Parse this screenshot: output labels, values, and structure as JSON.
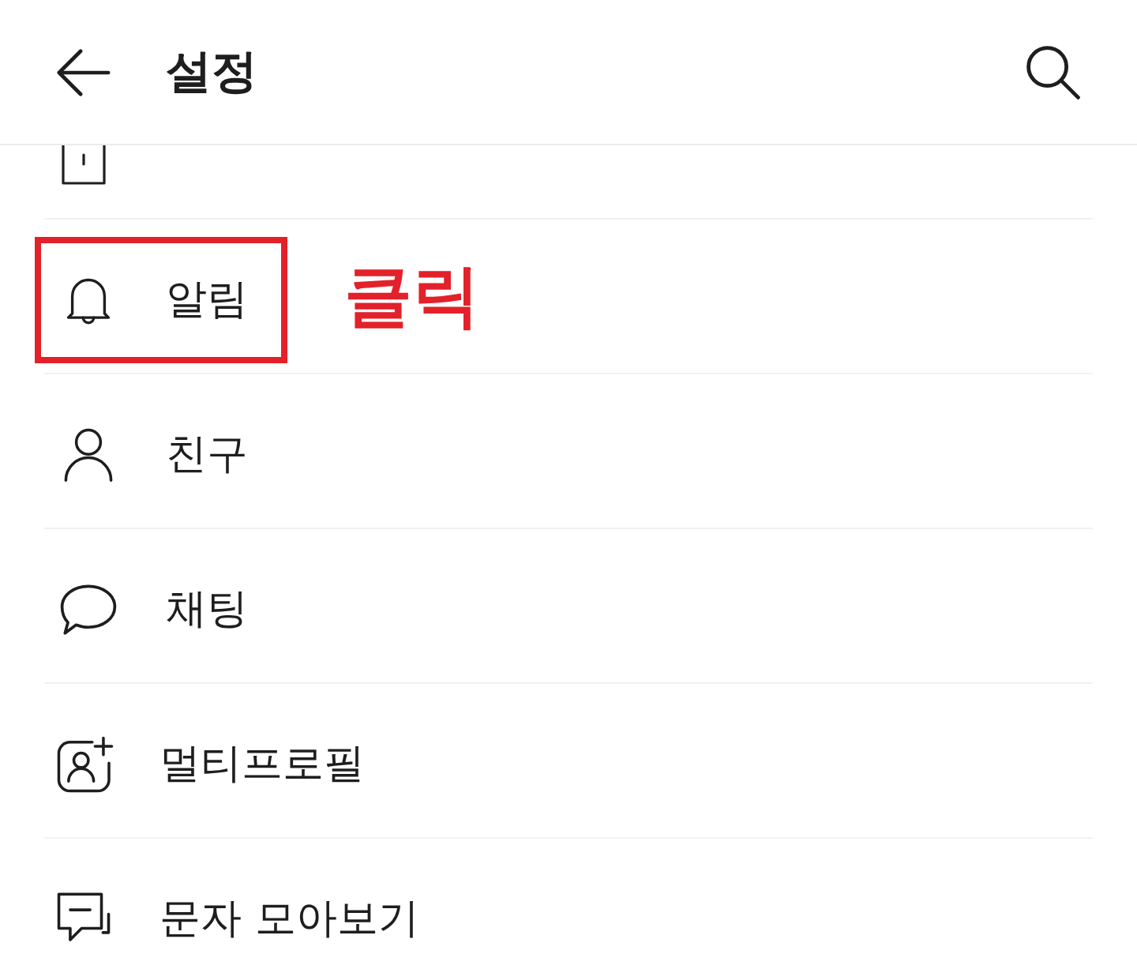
{
  "header": {
    "title": "설정"
  },
  "items": [
    {
      "label": "알림",
      "highlighted": true,
      "callout": "클릭"
    },
    {
      "label": "친구",
      "highlighted": false
    },
    {
      "label": "채팅",
      "highlighted": false
    },
    {
      "label": "멀티프로필",
      "highlighted": false
    },
    {
      "label": "문자 모아보기",
      "highlighted": false
    }
  ]
}
